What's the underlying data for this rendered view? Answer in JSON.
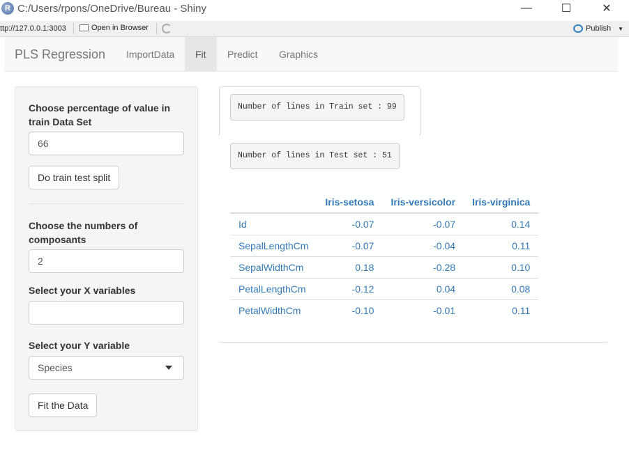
{
  "window": {
    "title": "C:/Users/rpons/OneDrive/Bureau - Shiny",
    "logo_letter": "R",
    "minimize": "—",
    "maximize": "☐",
    "close": "✕"
  },
  "toolbar": {
    "url": "ttp://127.0.0.1:3003",
    "open_in_browser": "Open in Browser",
    "publish": "Publish"
  },
  "navbar": {
    "brand": "PLS Regression",
    "tabs": [
      {
        "label": "ImportData",
        "active": false
      },
      {
        "label": "Fit",
        "active": true
      },
      {
        "label": "Predict",
        "active": false
      },
      {
        "label": "Graphics",
        "active": false
      }
    ]
  },
  "sidebar": {
    "pct_label": "Choose percentage of value in train Data Set",
    "pct_value": "66",
    "split_button": "Do train test split",
    "ncomp_label": "Choose the numbers of composants",
    "ncomp_value": "2",
    "x_label": "Select your X variables",
    "x_value": "",
    "y_label": "Select your Y variable",
    "y_value": "Species",
    "fit_button": "Fit the Data"
  },
  "main": {
    "train_text": "Number of lines in Train set : 99",
    "test_text": "Number of lines in Test set : 51",
    "table": {
      "headers": [
        "",
        "Iris-setosa",
        "Iris-versicolor",
        "Iris-virginica"
      ],
      "rows": [
        [
          "Id",
          "-0.07",
          "-0.07",
          "0.14"
        ],
        [
          "SepalLengthCm",
          "-0.07",
          "-0.04",
          "0.11"
        ],
        [
          "SepalWidthCm",
          "0.18",
          "-0.28",
          "0.10"
        ],
        [
          "PetalLengthCm",
          "-0.12",
          "0.04",
          "0.08"
        ],
        [
          "PetalWidthCm",
          "-0.10",
          "-0.01",
          "0.11"
        ]
      ]
    }
  },
  "colors": {
    "link_blue": "#337ab7",
    "navbar_bg": "#f8f8f8",
    "active_tab_bg": "#e7e7e7",
    "sidebar_bg": "#f5f5f5"
  }
}
